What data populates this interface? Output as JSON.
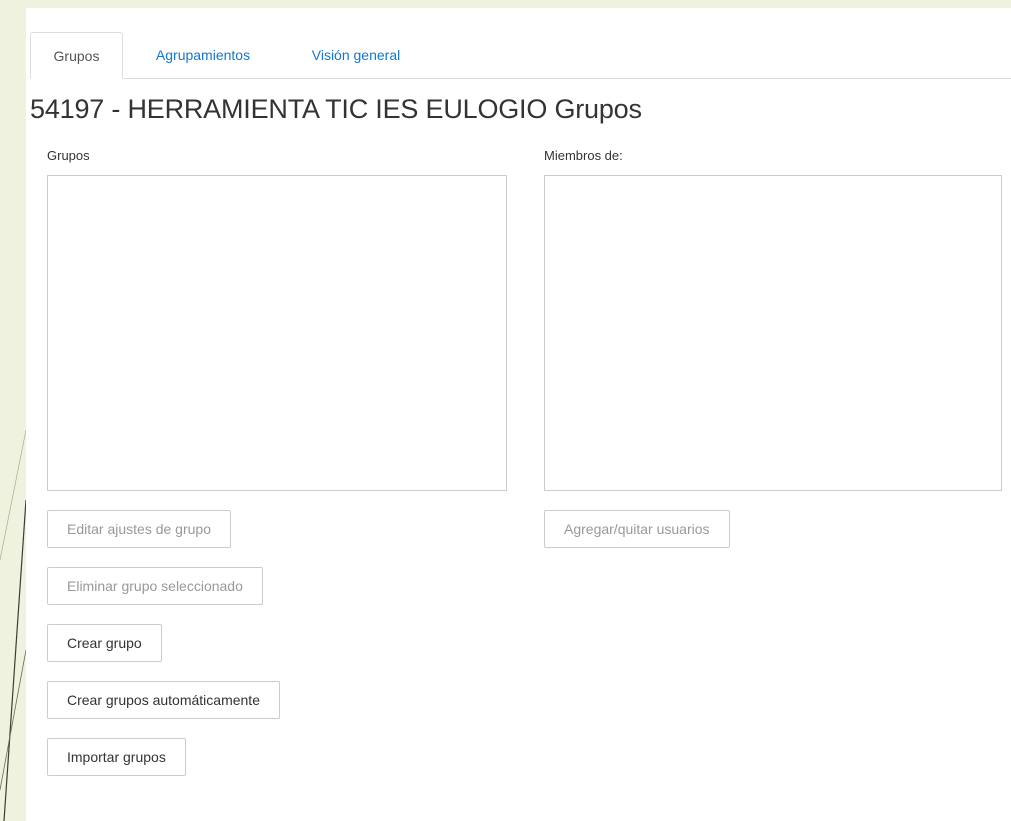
{
  "tabs": {
    "groups_label": "Grupos",
    "groupings_label": "Agrupamientos",
    "overview_label": "Visión general"
  },
  "page": {
    "title": "54197 - HERRAMIENTA TIC IES EULOGIO Grupos"
  },
  "groups_panel": {
    "label": "Grupos"
  },
  "members_panel": {
    "label": "Miembros de:"
  },
  "buttons": {
    "edit_group_settings": "Editar ajustes de grupo",
    "delete_selected_group": "Eliminar grupo seleccionado",
    "create_group": "Crear grupo",
    "auto_create_groups": "Crear grupos automáticamente",
    "import_groups": "Importar grupos",
    "add_remove_users": "Agregar/quitar usuarios"
  },
  "colors": {
    "link": "#1177d1",
    "disabled_text": "#999999",
    "border": "#cccccc",
    "slide_background": "#eef2de"
  }
}
